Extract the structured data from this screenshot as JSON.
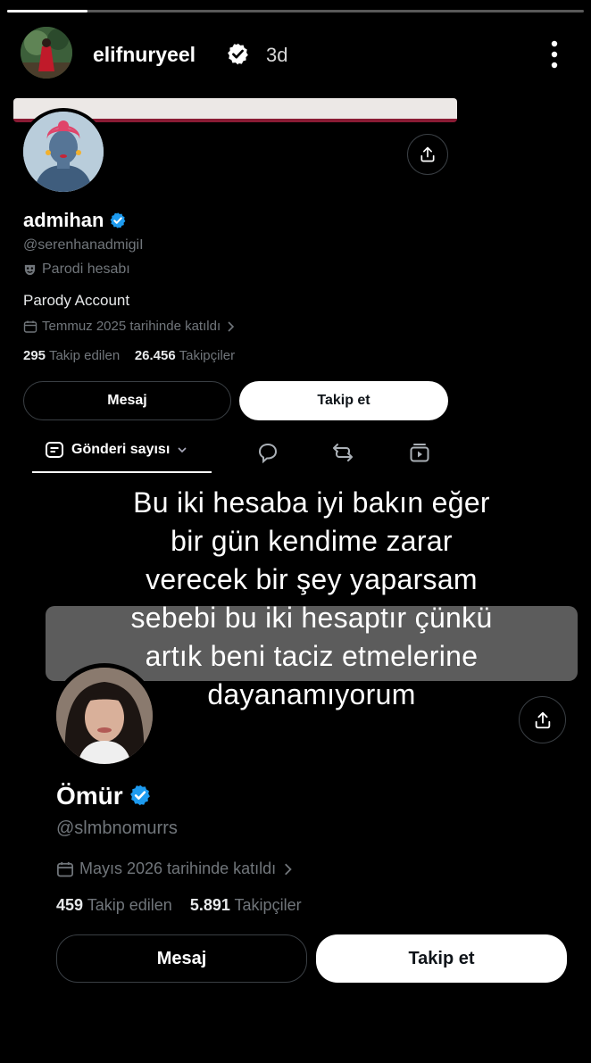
{
  "story": {
    "progress": 0.14,
    "username": "elifnuryeel",
    "time": "3d",
    "avatar_icon": "profile-photo",
    "more_icon": "more-vertical-icon"
  },
  "profile1": {
    "display_name": "admihan",
    "handle": "@serenhanadmigiI",
    "parody_label": "Parodi hesabı",
    "bio": "Parody Account",
    "joined": "Temmuz 2025 tarihinde katıldı",
    "following_count": "295",
    "following_label": "Takip edilen",
    "followers_count": "26.456",
    "followers_label": "Takipçiler",
    "message_label": "Mesaj",
    "follow_label": "Takip et",
    "banner_colors": [
      "#ece8e6",
      "#8a1b34"
    ]
  },
  "tabs": {
    "posts_label": "Gönderi sayısı",
    "icons": [
      "speech-bubble-icon",
      "repost-icon",
      "media-icon"
    ]
  },
  "overlay": {
    "lines": [
      "Bu iki hesaba iyi bakın eğer",
      "bir gün kendime zarar",
      "verecek bir şey yaparsam",
      "sebebi bu iki hesaptır çünkü",
      "artık beni taciz etmelerine",
      "dayanamıyorum"
    ]
  },
  "profile2": {
    "display_name": "Ömür",
    "handle": "@slmbnomurrs",
    "joined": "Mayıs 2026 tarihinde katıldı",
    "following_count": "459",
    "following_label": "Takip edilen",
    "followers_count": "5.891",
    "followers_label": "Takipçiler",
    "message_label": "Mesaj",
    "follow_label": "Takip et"
  },
  "colors": {
    "background": "#000000",
    "verified_blue": "#1d9bf0",
    "muted_text": "#71767b"
  }
}
